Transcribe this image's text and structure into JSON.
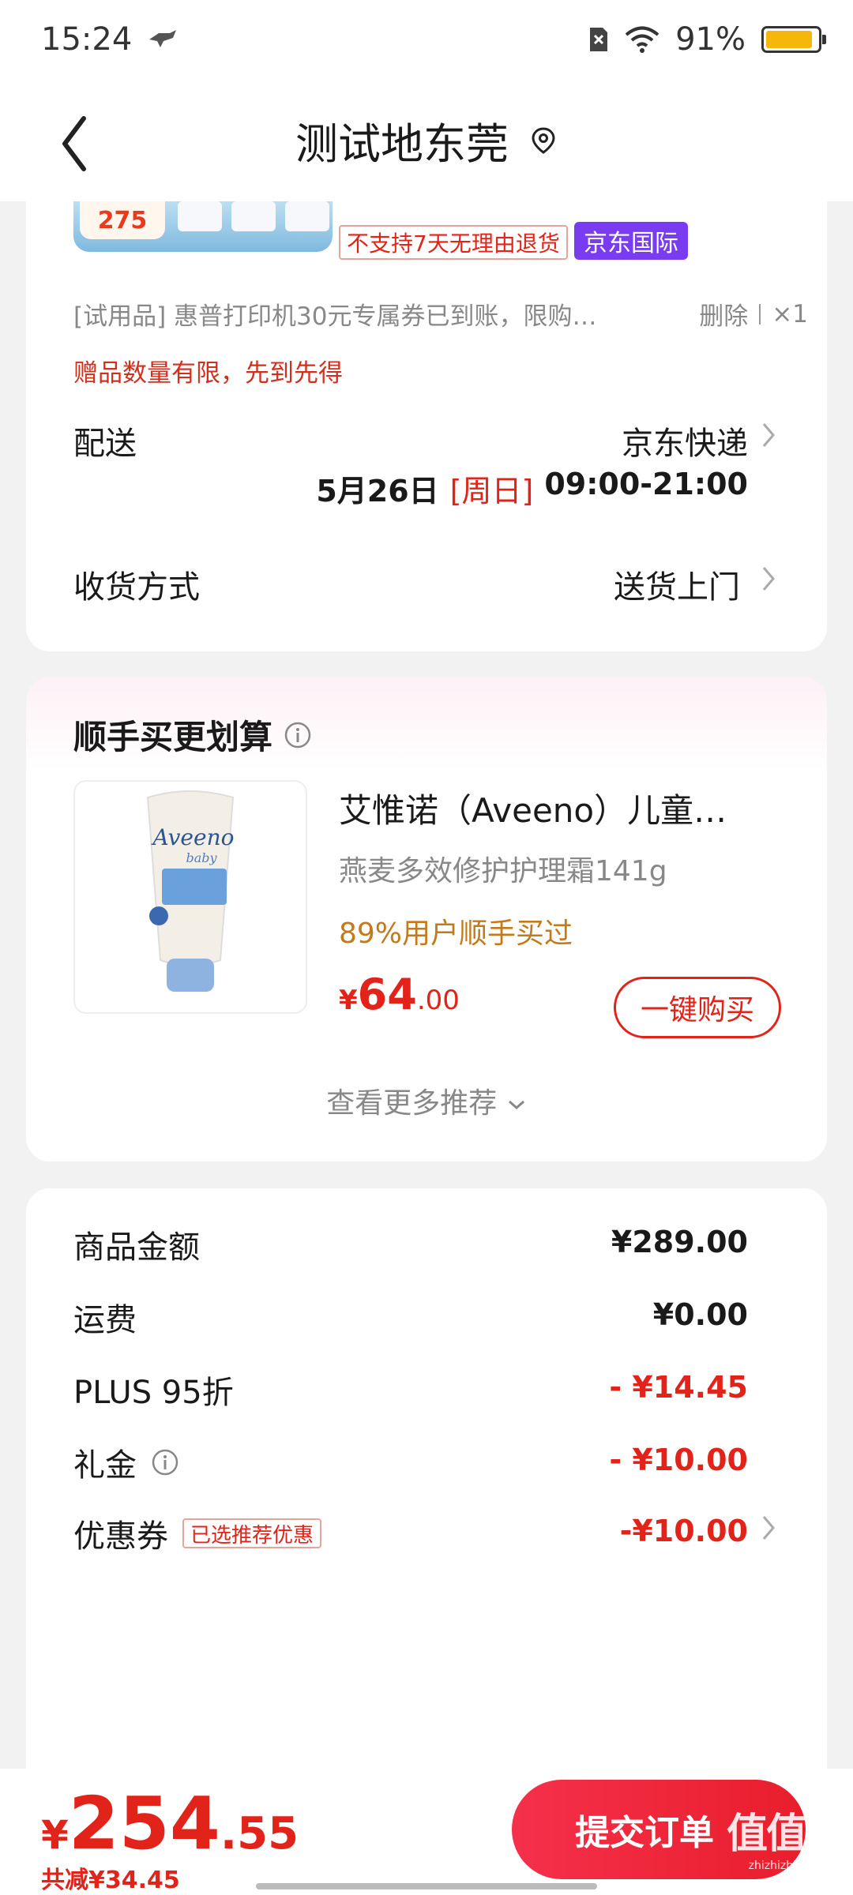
{
  "status_bar": {
    "time": "15:24",
    "battery": "91%",
    "battery_level": 0.91
  },
  "nav": {
    "title": "测试地东莞"
  },
  "product_top": {
    "badge": "275",
    "tag_no_return": "不支持7天无理由退货",
    "tag_intl": "京东国际"
  },
  "trial": {
    "text": "[试用品]  惠普打印机30元专属券已到账，限购…",
    "delete_label": "删除",
    "qty": "×1",
    "note": "赠品数量有限，先到先得"
  },
  "delivery": {
    "label": "配送",
    "value": "京东快递",
    "date": "5月26日",
    "weekday": "[周日]",
    "time": "09:00-21:00"
  },
  "receive": {
    "label": "收货方式",
    "value": "送货上门"
  },
  "recommend": {
    "title": "顺手买更划算",
    "name": "艾惟诺（Aveeno）儿童…",
    "subtitle": "燕麦多效修护护理霜141g",
    "bought": "89%用户顺手买过",
    "price_currency": "¥",
    "price_int": "64",
    "price_dec": ".00",
    "buy_label": "一键购买",
    "more_label": "查看更多推荐",
    "img_brand": "Aveeno",
    "img_sub": "baby"
  },
  "summary": {
    "items": [
      {
        "label": "商品金额",
        "value": "¥289.00",
        "red": false
      },
      {
        "label": "运费",
        "value": "¥0.00",
        "red": false
      },
      {
        "label": "PLUS 95折",
        "value": "- ¥14.45",
        "red": true
      },
      {
        "label": "礼金",
        "value": "- ¥10.00",
        "red": true
      },
      {
        "label": "优惠券",
        "value": "-¥10.00",
        "red": true
      }
    ],
    "coupon_tag": "已选推荐优惠"
  },
  "bottom": {
    "total_currency": "¥",
    "total_int": "254",
    "total_dec": ".55",
    "saved": "共减¥34.45",
    "submit_label": "提交订单",
    "watermark": "值值值",
    "watermark_site": "zhizhizhi.com"
  },
  "colors": {
    "accent_red": "#e2231a",
    "intl_purple": "#7a3cf0"
  }
}
